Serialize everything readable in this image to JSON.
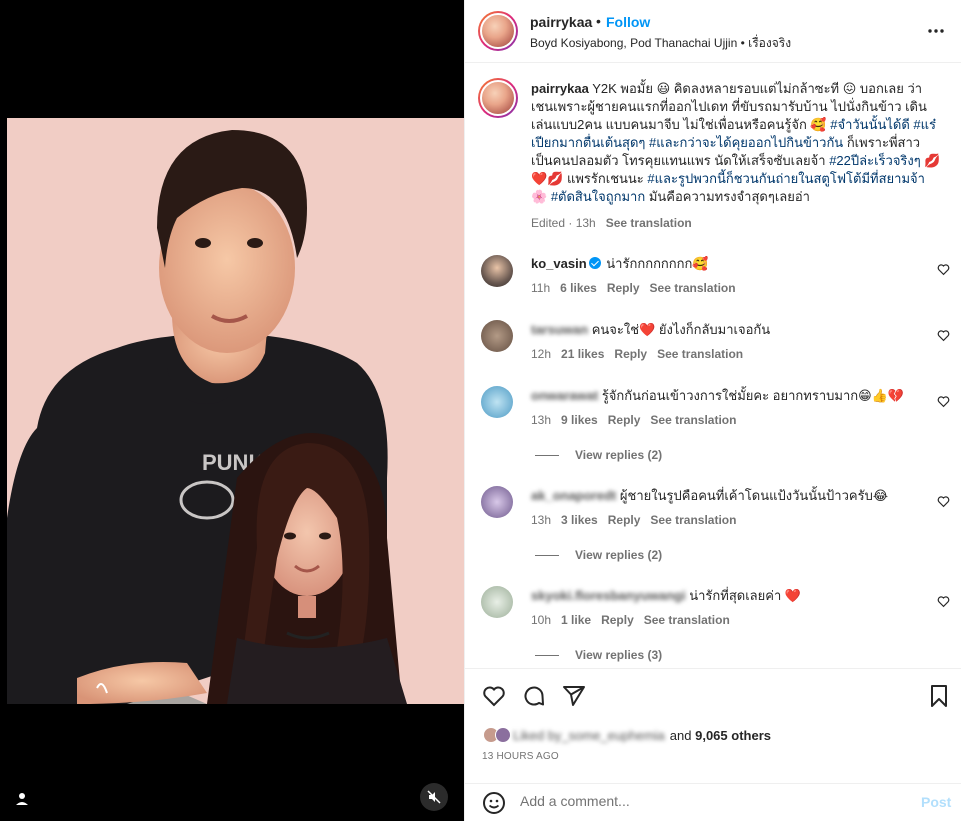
{
  "post": {
    "username": "pairrykaa",
    "dot": "•",
    "follow_label": "Follow",
    "subtitle": "Boyd Kosiyabong, Pod Thanachai Ujjin • เรื่องจริง"
  },
  "caption": {
    "username": "pairrykaa",
    "segments": [
      {
        "t": " Y2K พอมั้ย 😃 คิดลงหลายรอบแต่ไม่กล้าซะที 😖 บอกเลย ว่าเชนเพราะผู้ชายคนแรกที่ออกไปเดท ที่ขับรถมารับบ้าน ไปนั่งกินข้าว เดินเล่นแบบ2คน แบบคนมาจีบ ไม่ใช่เพื่อนหรือคนรู้จัก 🥰 ",
        "tag": false
      },
      {
        "t": "#จำวันนั้นได้ดี #แร๋เปียกมากตื่นเต้นสุดๆ #และกว่าจะได้คุยออกไปกินข้าวกัน",
        "tag": true
      },
      {
        "t": " ก็เพราะพี่สาวเป็นคนปลอมตัว โทรคุยแทนแพร นัดให้เสร็จซับเลยจ้า ",
        "tag": false
      },
      {
        "t": "#22ปีล่ะเร็วจริงๆ",
        "tag": true
      },
      {
        "t": " 💋❤️💋 แพรรักเชนนะ ",
        "tag": false
      },
      {
        "t": "#และรูปพวกนี้ก็ชวนกันถ่ายในสตูโฟโต้มีที่สยามจ้า",
        "tag": true
      },
      {
        "t": " 🌸 ",
        "tag": false
      },
      {
        "t": "#ตัดสินใจถูกมาก",
        "tag": true
      },
      {
        "t": " มันคือความทรงจำสุดๆเลยอ่า",
        "tag": false
      }
    ],
    "edited": "Edited · 13h",
    "see_translation": "See translation"
  },
  "comments": [
    {
      "user": "ko_vasin",
      "verified": true,
      "text": "น่ารักกกกกกกก🥰",
      "time": "11h",
      "likes": "6 likes",
      "reply": "Reply",
      "translate": "See translation",
      "view_replies": ""
    },
    {
      "user": "tarsuwan",
      "verified": false,
      "text": "คนจะใช่❤️ ยังไงก็กลับมาเจอกัน",
      "time": "12h",
      "likes": "21 likes",
      "reply": "Reply",
      "translate": "See translation",
      "view_replies": ""
    },
    {
      "user": "onwarawat",
      "verified": false,
      "text": "รู้จักกันก่อนเข้าวงการใช่มั้ยคะ อยากทราบมาก😁👍💔",
      "time": "13h",
      "likes": "9 likes",
      "reply": "Reply",
      "translate": "See translation",
      "view_replies": "View replies (2)"
    },
    {
      "user": "ak_onaporedt",
      "verified": false,
      "text": "ผู้ชายในรูปคือคนที่เค้าโดนแป้งวันนั้นป้าวครับ😂",
      "time": "13h",
      "likes": "3 likes",
      "reply": "Reply",
      "translate": "See translation",
      "view_replies": "View replies (2)"
    },
    {
      "user": "skyoki.floresbanyuwangi",
      "verified": false,
      "text": "น่ารักที่สุดเลยค่า ❤️",
      "time": "10h",
      "likes": "1 like",
      "reply": "Reply",
      "translate": "See translation",
      "view_replies": "View replies (3)"
    }
  ],
  "likes": {
    "liked_by_blurred": "Liked by_some_euphemia",
    "and_label": "and",
    "count": "9,065 others"
  },
  "time_ago": "13 HOURS AGO",
  "composer": {
    "placeholder": "Add a comment...",
    "post_label": "Post"
  },
  "photo": {
    "shirt_text": "PUNK"
  },
  "icons": [
    "more-icon",
    "heart-icon",
    "comment-icon",
    "share-icon",
    "bookmark-icon",
    "emoji-icon",
    "tag-user-icon",
    "mute-icon"
  ],
  "colors": {
    "accent": "#0095f6",
    "hashtag": "#00376b",
    "muted": "#737373",
    "post_disabled": "#b2dffc"
  }
}
